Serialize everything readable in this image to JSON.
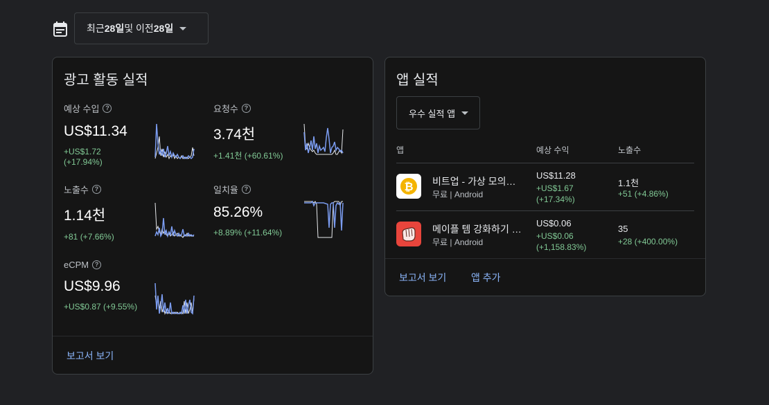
{
  "date_range": {
    "prefix": "최근 ",
    "days1": "28일",
    "mid": " 및 이전 ",
    "days2": "28일"
  },
  "ads_card": {
    "title": "광고 활동 실적",
    "metrics": [
      {
        "label": "예상 수입",
        "value": "US$11.34",
        "delta1": "+US$1.72",
        "delta2": "(+17.94%)"
      },
      {
        "label": "요청수",
        "value": "3.74천",
        "delta1": "+1.41천 (+60.61%)",
        "delta2": ""
      },
      {
        "label": "노출수",
        "value": "1.14천",
        "delta1": "+81 (+7.66%)",
        "delta2": ""
      },
      {
        "label": "일치율",
        "value": "85.26%",
        "delta1": "+8.89% (+11.64%)",
        "delta2": ""
      },
      {
        "label": "eCPM",
        "value": "US$9.96",
        "delta1": "+US$0.87 (+9.55%)",
        "delta2": ""
      }
    ],
    "footer_link": "보고서 보기"
  },
  "app_card": {
    "title": "앱 실적",
    "selector": "우수 실적 앱",
    "headers": {
      "app": "앱",
      "revenue": "예상 수익",
      "impressions": "노출수"
    },
    "rows": [
      {
        "name": "비트업 - 가상 모의투자",
        "sub": "무료 | Android",
        "revenue": "US$11.28",
        "revenue_delta1": "+US$1.67",
        "revenue_delta2": "(+17.34%)",
        "impressions": "1.1천",
        "impressions_delta": "+51 (+4.86%)",
        "icon": "bitcoin-icon"
      },
      {
        "name": "메이플 템 강화하기 시뮬",
        "sub": "무료 | Android",
        "revenue": "US$0.06",
        "revenue_delta1": "+US$0.06",
        "revenue_delta2": "(+1,158.83%)",
        "impressions": "35",
        "impressions_delta": "+28 (+400.00%)",
        "icon": "glove-icon"
      }
    ],
    "footer_links": [
      "보고서 보기",
      "앱 추가"
    ]
  },
  "colors": {
    "accent": "#8ab4f8",
    "positive": "#81c995",
    "spark_current": "#7b9cf0",
    "spark_previous": "#e8eaed"
  }
}
